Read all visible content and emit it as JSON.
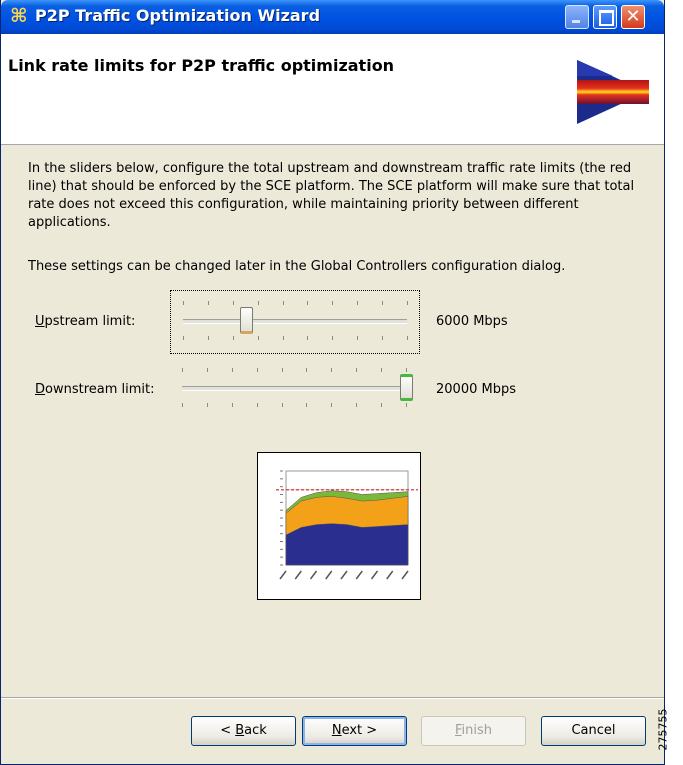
{
  "window": {
    "title": "P2P Traffic Optimization Wizard",
    "controls": [
      "minimize-icon",
      "maximize-icon",
      "close-icon"
    ]
  },
  "header": {
    "title": "Link rate limits for P2P traffic optimization",
    "banner_icon": "wizard-arrow-icon"
  },
  "body": {
    "description": "In the sliders below, configure the total upstream and downstream traffic rate limits (the red line) that should be enforced by the SCE platform. The SCE platform will make sure that total rate does not exceed this configuration, while maintaining priority between different applications.",
    "note": "These settings can be changed later in the Global Controllers configuration dialog."
  },
  "sliders": {
    "upstream": {
      "label_mnemonic": "U",
      "label_rest": "pstream limit:",
      "value": "6000 Mbps",
      "level": 0.28
    },
    "downstream": {
      "label_mnemonic": "D",
      "label_rest": "ownstream limit:",
      "value": "20000 Mbps",
      "level": 1.0
    }
  },
  "chart_data": {
    "type": "area",
    "title": "",
    "series": [
      {
        "values": [
          32,
          40,
          43,
          44,
          43,
          40,
          41,
          42,
          43
        ]
      },
      {
        "values": [
          55,
          68,
          72,
          73,
          71,
          68,
          69,
          71,
          73
        ]
      },
      {
        "values": [
          58,
          72,
          77,
          79,
          78,
          75,
          76,
          77,
          78
        ]
      }
    ],
    "limit_line": 80,
    "ylim": [
      0,
      100
    ],
    "colors": {
      "bottom": "#2a2f8f",
      "middle": "#f4a11a",
      "top": "#7ab83a",
      "limit": "#e02020"
    }
  },
  "buttons": {
    "back_pre": "< ",
    "back_mnemonic": "B",
    "back_rest": "ack",
    "next_mnemonic": "N",
    "next_rest": "ext >",
    "finish_mnemonic": "F",
    "finish_rest": "inish",
    "cancel": "Cancel"
  },
  "side_label": "275755"
}
